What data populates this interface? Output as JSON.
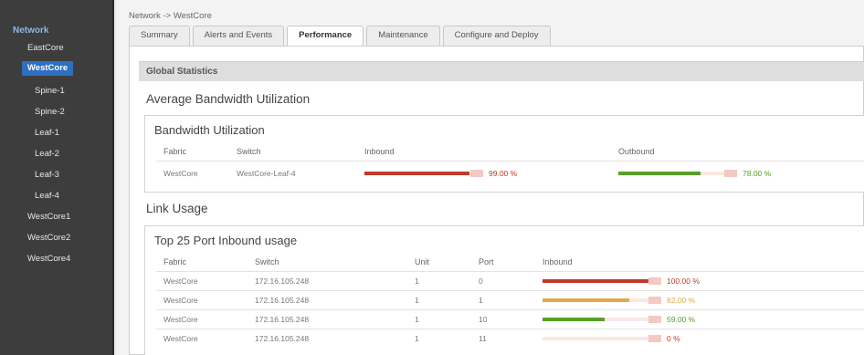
{
  "sidebar": {
    "root": "Network",
    "items": [
      {
        "label": "EastCore",
        "active": false
      },
      {
        "label": "WestCore",
        "active": true
      },
      {
        "label": "Spine-1",
        "active": false
      },
      {
        "label": "Spine-2",
        "active": false
      },
      {
        "label": "Leaf-1",
        "active": false
      },
      {
        "label": "Leaf-2",
        "active": false
      },
      {
        "label": "Leaf-3",
        "active": false
      },
      {
        "label": "Leaf-4",
        "active": false
      },
      {
        "label": "WestCore1",
        "active": false
      },
      {
        "label": "WestCore2",
        "active": false
      },
      {
        "label": "WestCore4",
        "active": false
      }
    ]
  },
  "breadcrumb": "Network -> WestCore",
  "tabs": [
    {
      "label": "Summary",
      "active": false
    },
    {
      "label": "Alerts and Events",
      "active": false
    },
    {
      "label": "Performance",
      "active": true
    },
    {
      "label": "Maintenance",
      "active": false
    },
    {
      "label": "Configure and Deploy",
      "active": false
    }
  ],
  "global_stats_label": "Global Statistics",
  "avg_bw_heading": "Average Bandwidth Utilization",
  "bw_box": {
    "title": "Bandwidth Utilization",
    "columns": {
      "fabric": "Fabric",
      "switch": "Switch",
      "inbound": "Inbound",
      "outbound": "Outbound"
    },
    "row": {
      "fabric": "WestCore",
      "switch": "WestCore-Leaf-4",
      "inbound_value": 99.0,
      "inbound_label": "99.00 %",
      "inbound_color": "#c0392b",
      "outbound_value": 78.0,
      "outbound_label": "78.00 %",
      "outbound_color": "#5a9e2a"
    }
  },
  "link_usage_heading": "Link Usage",
  "port_box": {
    "title": "Top 25 Port Inbound usage",
    "columns": {
      "fabric": "Fabric",
      "switch": "Switch",
      "unit": "Unit",
      "port": "Port",
      "inbound": "Inbound"
    },
    "rows": [
      {
        "fabric": "WestCore",
        "switch": "172.16.105.248",
        "unit": "1",
        "port": "0",
        "value": 100.0,
        "label": "100.00 %",
        "color": "#c0392b"
      },
      {
        "fabric": "WestCore",
        "switch": "172.16.105.248",
        "unit": "1",
        "port": "1",
        "value": 82.0,
        "label": "82.00 %",
        "color": "#e3a94a"
      },
      {
        "fabric": "WestCore",
        "switch": "172.16.105.248",
        "unit": "1",
        "port": "10",
        "value": 59.0,
        "label": "59.00 %",
        "color": "#5a9e2a"
      },
      {
        "fabric": "WestCore",
        "switch": "172.16.105.248",
        "unit": "1",
        "port": "11",
        "value": 0.0,
        "label": "0 %",
        "color": "#c0392b"
      }
    ]
  }
}
